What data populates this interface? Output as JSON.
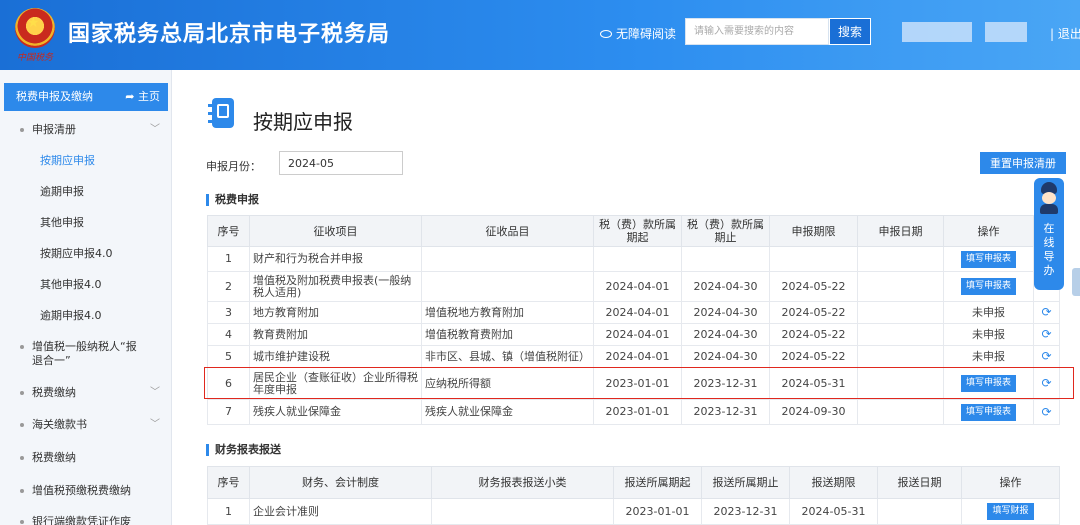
{
  "header": {
    "emblem_text": "中国税务",
    "title": "国家税务总局北京市电子税务局",
    "accessibility": "无障碍阅读",
    "search_placeholder": "请输入需要搜索的内容",
    "search_button": "搜索",
    "logout": "| 退出"
  },
  "sidebar": {
    "head": "税费申报及缴纳",
    "home": "主页",
    "items": [
      {
        "label": "申报清册"
      },
      {
        "label": "按期应申报"
      },
      {
        "label": "逾期申报"
      },
      {
        "label": "其他申报"
      },
      {
        "label": "按期应申报4.0"
      },
      {
        "label": "其他申报4.0"
      },
      {
        "label": "逾期申报4.0"
      },
      {
        "label": "增值税一般纳税人“报退合一”"
      },
      {
        "label": "税费缴纳"
      },
      {
        "label": "海关缴款书"
      },
      {
        "label": "税费缴纳"
      },
      {
        "label": "增值税预缴税费缴纳"
      },
      {
        "label": "银行端缴款凭证作废"
      }
    ]
  },
  "main": {
    "title": "按期应申报",
    "month_label": "申报月份：",
    "month_value": "2024-05",
    "reset_button": "重置申报清册",
    "tax_section": "税费申报",
    "tax_headers": [
      "序号",
      "征收项目",
      "征收品目",
      "税（费）款所属期起",
      "税（费）款所属期止",
      "申报期限",
      "申报日期",
      "操作"
    ],
    "tax_rows": [
      {
        "no": "1",
        "item": "财产和行为税合并申报",
        "sub": "",
        "start": "",
        "end": "",
        "deadline": "",
        "date": "",
        "action": "填写申报表",
        "refresh": false
      },
      {
        "no": "2",
        "item": "增值税及附加税费申报表(一般纳税人适用)",
        "sub": "",
        "start": "2024-04-01",
        "end": "2024-04-30",
        "deadline": "2024-05-22",
        "date": "",
        "action": "填写申报表",
        "refresh": false
      },
      {
        "no": "3",
        "item": "地方教育附加",
        "sub": "增值税地方教育附加",
        "start": "2024-04-01",
        "end": "2024-04-30",
        "deadline": "2024-05-22",
        "date": "",
        "action": "未申报",
        "refresh": true
      },
      {
        "no": "4",
        "item": "教育费附加",
        "sub": "增值税教育费附加",
        "start": "2024-04-01",
        "end": "2024-04-30",
        "deadline": "2024-05-22",
        "date": "",
        "action": "未申报",
        "refresh": true
      },
      {
        "no": "5",
        "item": "城市维护建设税",
        "sub": "非市区、县城、镇（增值税附征）",
        "start": "2024-04-01",
        "end": "2024-04-30",
        "deadline": "2024-05-22",
        "date": "",
        "action": "未申报",
        "refresh": true
      },
      {
        "no": "6",
        "item": "居民企业（查账征收）企业所得税年度申报",
        "sub": "应纳税所得额",
        "start": "2023-01-01",
        "end": "2023-12-31",
        "deadline": "2024-05-31",
        "date": "",
        "action": "填写申报表",
        "refresh": true
      },
      {
        "no": "7",
        "item": "残疾人就业保障金",
        "sub": "残疾人就业保障金",
        "start": "2023-01-01",
        "end": "2023-12-31",
        "deadline": "2024-09-30",
        "date": "",
        "action": "填写申报表",
        "refresh": true
      }
    ],
    "fin_section": "财务报表报送",
    "fin_headers": [
      "序号",
      "财务、会计制度",
      "财务报表报送小类",
      "报送所属期起",
      "报送所属期止",
      "报送期限",
      "报送日期",
      "操作"
    ],
    "fin_rows": [
      {
        "no": "1",
        "system": "企业会计准则",
        "sub": "",
        "start": "2023-01-01",
        "end": "2023-12-31",
        "deadline": "2024-05-31",
        "date": "",
        "action": "填写财报"
      }
    ]
  },
  "guide": {
    "text": "在线导办"
  }
}
